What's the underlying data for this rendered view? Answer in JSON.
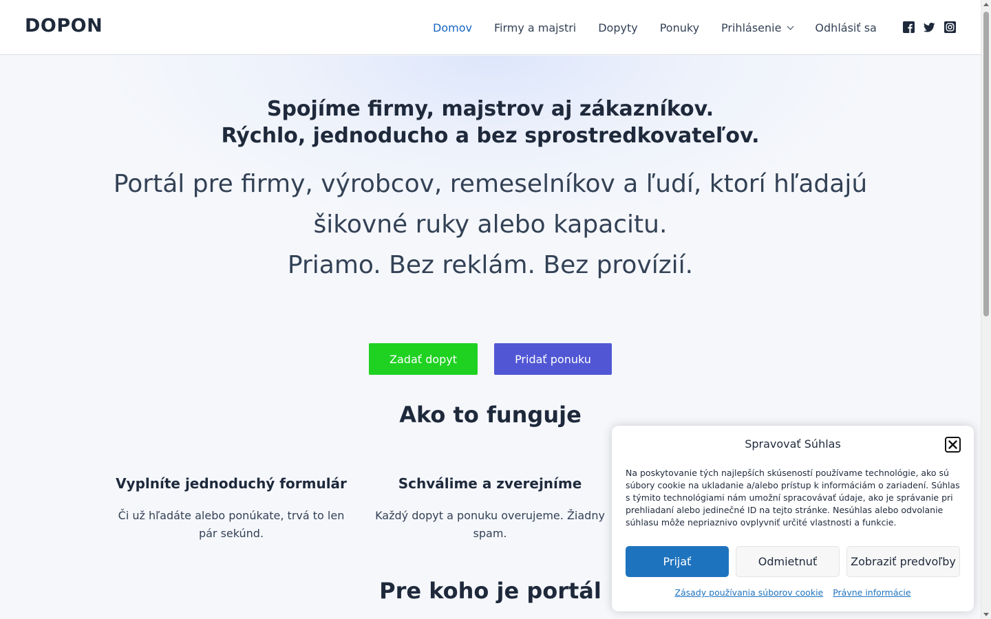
{
  "header": {
    "logo": "DOPON",
    "nav": [
      {
        "label": "Domov"
      },
      {
        "label": "Firmy a majstri"
      },
      {
        "label": "Dopyty"
      },
      {
        "label": "Ponuky"
      },
      {
        "label": "Prihlásenie"
      },
      {
        "label": "Odhlásiť sa"
      }
    ],
    "social_icons": [
      "facebook-icon",
      "twitter-icon",
      "instagram-icon"
    ]
  },
  "hero": {
    "headline_1": "Spojíme firmy, majstrov aj zákazníkov.",
    "headline_2": "Rýchlo, jednoducho a bez sprostredkovateľov.",
    "lead_1": "Portál pre firmy, výrobcov, remeselníkov a ľudí, ktorí hľadajú",
    "lead_2": "šikovné ruky alebo kapacitu.",
    "lead_3": "Priamo. Bez reklám. Bez provízií.",
    "primary_button": "Zadať dopyt",
    "secondary_button": "Pridať ponuku"
  },
  "how_it_works": {
    "title": "Ako to funguje",
    "steps": [
      {
        "title": "Vyplníte jednoduchý formulár",
        "text": "Či už hľadáte alebo ponúkate, trvá to len pár sekúnd."
      },
      {
        "title": "Schválime a zverejníme",
        "text": "Každý dopyt a ponuku overujeme. Žiadny spam."
      }
    ]
  },
  "for_whom": {
    "title": "Pre koho je portál"
  },
  "cookie_banner": {
    "title": "Spravovať Súhlas",
    "text": "Na poskytovanie tých najlepších skúseností používame technológie, ako sú súbory cookie na ukladanie a/alebo prístup k informáciám o zariadení. Súhlas s týmito technológiami nám umožní spracovávať údaje, ako je správanie pri prehliadaní alebo jedinečné ID na tejto stránke. Nesúhlas alebo odvolanie súhlasu môže nepriaznivo ovplyvniť určité vlastnosti a funkcie.",
    "accept": "Prijať",
    "deny": "Odmietnuť",
    "preferences": "Zobraziť predvoľby",
    "link_cookies": "Zásady používania súborov cookie",
    "link_legal": "Právne informácie"
  },
  "colors": {
    "accent_nav": "#1565c0",
    "button_green": "#1fd121",
    "button_purple": "#5157d4",
    "cookie_accept": "#1e73be"
  }
}
